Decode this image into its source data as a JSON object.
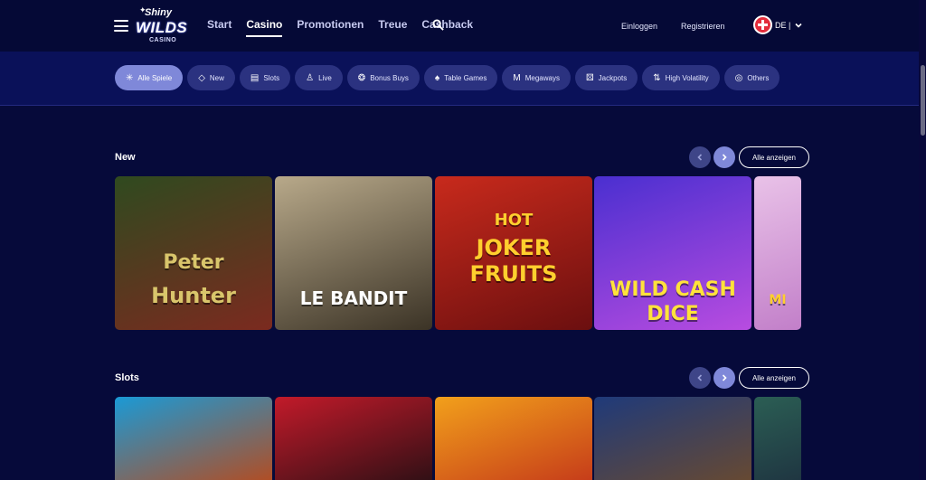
{
  "header": {
    "logo": {
      "line1": "Shiny",
      "line2": "WILDS",
      "line3": "CASINO"
    },
    "nav": [
      "Start",
      "Casino",
      "Promotionen",
      "Treue",
      "Cashback"
    ],
    "login": "Einloggen",
    "register": "Registrieren",
    "language": "DE |"
  },
  "categories": [
    {
      "label": "Alle Spiele",
      "icon": "sparkle-icon",
      "glyph": "✳"
    },
    {
      "label": "New",
      "icon": "diamond-icon",
      "glyph": "◇"
    },
    {
      "label": "Slots",
      "icon": "slot-machine-icon",
      "glyph": "▤"
    },
    {
      "label": "Live",
      "icon": "dealer-icon",
      "glyph": "♙"
    },
    {
      "label": "Bonus Buys",
      "icon": "coin-icon",
      "glyph": "❂"
    },
    {
      "label": "Table Games",
      "icon": "cards-icon",
      "glyph": "♠"
    },
    {
      "label": "Megaways",
      "icon": "m-icon",
      "glyph": "M"
    },
    {
      "label": "Jackpots",
      "icon": "dice-icon",
      "glyph": "⚄"
    },
    {
      "label": "High Volatility",
      "icon": "bars-icon",
      "glyph": "⇅"
    },
    {
      "label": "Others",
      "icon": "gamepad-icon",
      "glyph": "◎"
    }
  ],
  "sections": [
    {
      "title": "New",
      "show_all": "Alle anzeigen",
      "games": [
        {
          "title_line1": "Peter",
          "title_line2": "Hunter",
          "bg1": "#2f4a1f",
          "bg2": "#7b2a1f",
          "text_color": "#d9c56b"
        },
        {
          "title_line1": "",
          "title_line2": "LE BANDIT",
          "bg1": "#b8a98a",
          "bg2": "#3b3326",
          "text_color": "#ffffff"
        },
        {
          "title_line1": "HOT",
          "title_line2": "JOKER FRUITS",
          "bg1": "#c82a1c",
          "bg2": "#6b0f0f",
          "text_color": "#ffcf2e"
        },
        {
          "title_line1": "WILD CASH",
          "title_line2": "DICE",
          "bg1": "#4a2fd0",
          "bg2": "#b84ce0",
          "text_color": "#ffe23b"
        },
        {
          "title_line1": "",
          "title_line2": "MI",
          "bg1": "#e9c2e8",
          "bg2": "#c27fc9",
          "text_color": "#ffcf2e"
        }
      ]
    },
    {
      "title": "Slots",
      "show_all": "Alle anzeigen",
      "games": [
        {
          "bg1": "#1a9ad6",
          "bg2": "#b84a1c"
        },
        {
          "bg1": "#c21a2a",
          "bg2": "#2a0f14"
        },
        {
          "bg1": "#f2a01b",
          "bg2": "#c4381a"
        },
        {
          "bg1": "#1f3a7a",
          "bg2": "#6a4a2f"
        },
        {
          "bg1": "#2b5e54",
          "bg2": "#1e3340"
        }
      ]
    }
  ]
}
